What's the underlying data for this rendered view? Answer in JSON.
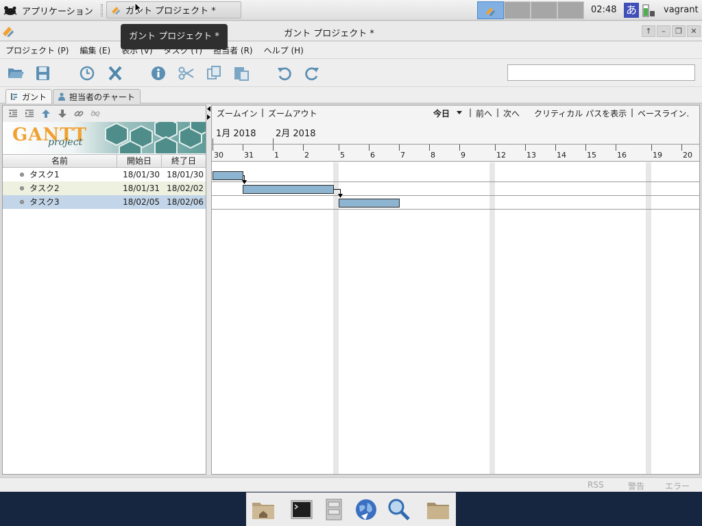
{
  "panel": {
    "apps_label": "アプリケーション",
    "task_label": "ガント プロジェクト *",
    "clock": "02:48",
    "ime": "あ",
    "user": "vagrant"
  },
  "tooltip": "ガント プロジェクト *",
  "window": {
    "title": "ガント プロジェクト *",
    "buttons": [
      "↑",
      "–",
      "❐",
      "✕"
    ]
  },
  "menu": [
    "プロジェクト (P)",
    "編集 (E)",
    "表示 (V)",
    "タスク (T)",
    "担当者 (R)",
    "ヘルプ (H)"
  ],
  "search": {
    "value": ""
  },
  "tabs": [
    {
      "label": "ガント",
      "icon": "gantt-tab-icon"
    },
    {
      "label": "担当者のチャート",
      "icon": "people-icon"
    }
  ],
  "logo": {
    "main": "GANTT",
    "sub": "project"
  },
  "table": {
    "headers": [
      "名前",
      "開始日",
      "終了日"
    ],
    "rows": [
      {
        "name": "タスク1",
        "start": "18/01/30",
        "end": "18/01/30"
      },
      {
        "name": "タスク2",
        "start": "18/01/31",
        "end": "18/02/02"
      },
      {
        "name": "タスク3",
        "start": "18/02/05",
        "end": "18/02/06"
      }
    ]
  },
  "chart_nav": {
    "zoom_in": "ズームイン",
    "sep1": "|",
    "zoom_out": "ズームアウト",
    "today": "今日",
    "sep2": "|",
    "prev": "前へ",
    "sep3": "|",
    "next": "次へ",
    "critical": "クリティカル パスを表示",
    "sep4": "|",
    "baseline": "ベースライン."
  },
  "months": [
    "1月 2018",
    "2月 2018"
  ],
  "days": [
    "30",
    "31",
    "1",
    "2",
    "5",
    "6",
    "7",
    "8",
    "9",
    "12",
    "13",
    "14",
    "15",
    "16",
    "19",
    "20"
  ],
  "status": {
    "rss": "RSS",
    "warning": "警告",
    "error": "エラー"
  },
  "colors": {
    "bar": "#8db4d0",
    "selected_row": "#c3d5e9",
    "alt_row": "#eef0e0",
    "accent": "#4b88cc"
  }
}
